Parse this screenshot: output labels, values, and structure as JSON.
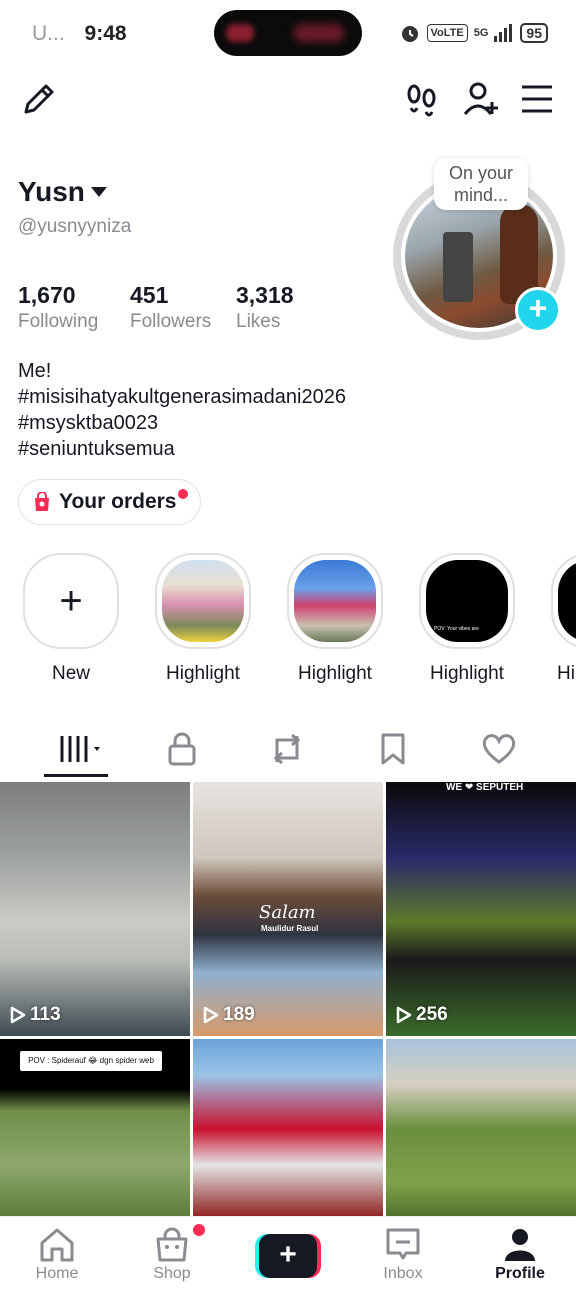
{
  "status_bar": {
    "carrier": "U...",
    "time": "9:48",
    "volte": "VoLTE",
    "network": "5G",
    "battery": "95"
  },
  "profile": {
    "display_name": "Yusn",
    "handle": "@yusnyyniza",
    "stats": [
      {
        "value": "1,670",
        "label": "Following"
      },
      {
        "value": "451",
        "label": "Followers"
      },
      {
        "value": "3,318",
        "label": "Likes"
      }
    ],
    "bio_lines": [
      "Me!",
      "#misisihatyakultgenerasimadani2026",
      "#msysktba0023",
      "#seniuntuksemua"
    ],
    "orders_label": "Your orders",
    "avatar_bubble": "On your mind..."
  },
  "highlights": [
    {
      "label": "New"
    },
    {
      "label": "Highlight"
    },
    {
      "label": "Highlight"
    },
    {
      "label": "Highlight"
    },
    {
      "label": "Hi"
    }
  ],
  "highlight_caption": "POV: Your vibes are",
  "videos": [
    {
      "views": "113"
    },
    {
      "views": "189",
      "overlay_title": "Salam",
      "overlay_sub": "Maulidur Rasul"
    },
    {
      "views": "256",
      "banner": "WE ❤ SEPUTEH"
    },
    {
      "caption": "POV : Spiderauf 😂 dgn spider web"
    },
    {},
    {}
  ],
  "bottom_nav": {
    "home": "Home",
    "shop": "Shop",
    "inbox": "Inbox",
    "profile": "Profile"
  },
  "colors": {
    "accent_cyan": "#20d5ec",
    "accent_red": "#fe2c55",
    "text_primary": "#161823",
    "text_secondary": "#8a8b91"
  }
}
